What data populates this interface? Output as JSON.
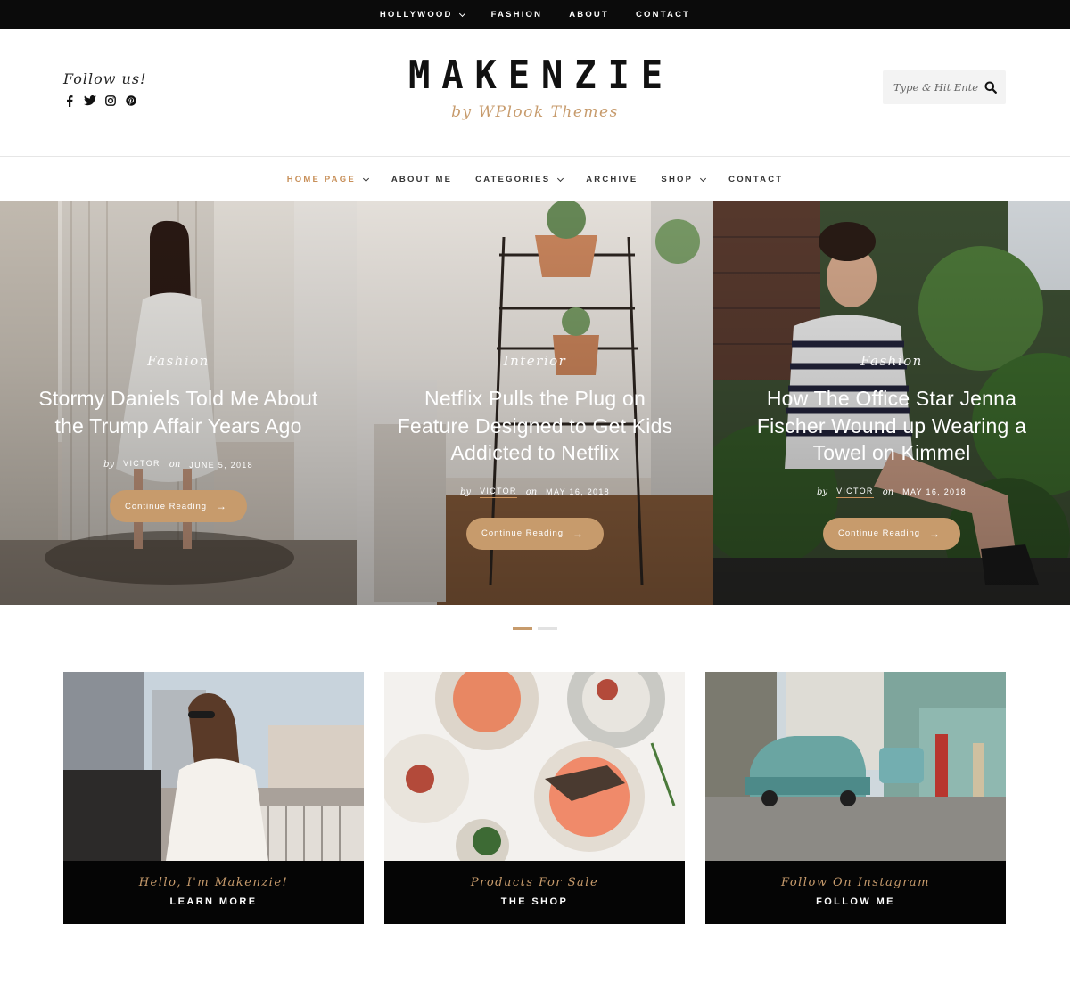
{
  "topbar": {
    "items": [
      {
        "label": "HOLLYWOOD",
        "dropdown": true
      },
      {
        "label": "FASHION",
        "dropdown": false
      },
      {
        "label": "ABOUT",
        "dropdown": false
      },
      {
        "label": "CONTACT",
        "dropdown": false
      }
    ]
  },
  "header": {
    "follow_label": "Follow us!",
    "social_icons": [
      "facebook-icon",
      "twitter-icon",
      "instagram-icon",
      "pinterest-icon"
    ],
    "logo_name": "MAKENZIE",
    "logo_tagline": "by WPlook Themes",
    "search_placeholder": "Type & Hit Enter ..."
  },
  "nav": {
    "items": [
      {
        "label": "HOME PAGE",
        "dropdown": true,
        "active": true
      },
      {
        "label": "ABOUT ME",
        "dropdown": false,
        "active": false
      },
      {
        "label": "CATEGORIES",
        "dropdown": true,
        "active": false
      },
      {
        "label": "ARCHIVE",
        "dropdown": false,
        "active": false
      },
      {
        "label": "SHOP",
        "dropdown": true,
        "active": false
      },
      {
        "label": "CONTACT",
        "dropdown": false,
        "active": false
      }
    ]
  },
  "slides": [
    {
      "category": "Fashion",
      "title": "Stormy Daniels Told Me About the Trump Affair Years Ago",
      "by": "by",
      "author": "VICTOR",
      "on": "on",
      "date": "JUNE 5, 2018",
      "button": "Continue Reading"
    },
    {
      "category": "Interior",
      "title": "Netflix Pulls the Plug on Feature Designed to Get Kids Addicted to Netflix",
      "by": "by",
      "author": "VICTOR",
      "on": "on",
      "date": "MAY 16, 2018",
      "button": "Continue Reading"
    },
    {
      "category": "Fashion",
      "title": "How The Office Star Jenna Fischer Wound up Wearing a Towel on Kimmel",
      "by": "by",
      "author": "VICTOR",
      "on": "on",
      "date": "MAY 16, 2018",
      "button": "Continue Reading"
    }
  ],
  "slider_dots": {
    "count": 2,
    "active": 0
  },
  "cards": [
    {
      "subtitle": "Hello, I'm Makenzie!",
      "label": "LEARN MORE"
    },
    {
      "subtitle": "Products For Sale",
      "label": "THE SHOP"
    },
    {
      "subtitle": "Follow On Instagram",
      "label": "FOLLOW ME"
    }
  ],
  "colors": {
    "accent": "#c79b6c",
    "nav_active": "#c8905a",
    "topbar": "#0b0b0b",
    "card_band": "#050505"
  }
}
